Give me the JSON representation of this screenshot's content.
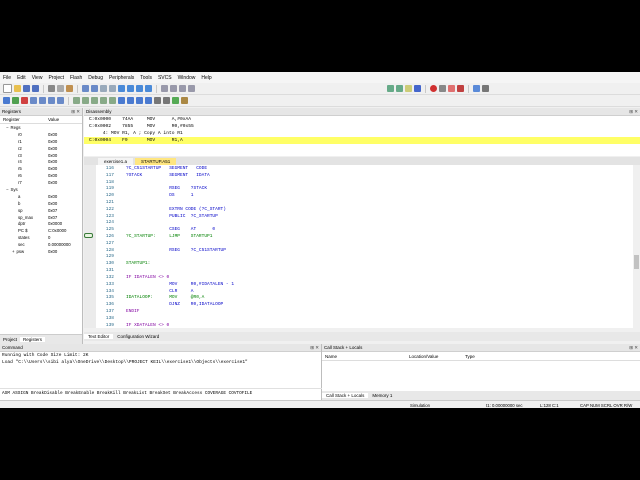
{
  "menu": [
    "File",
    "Edit",
    "View",
    "Project",
    "Flash",
    "Debug",
    "Peripherals",
    "Tools",
    "SVCS",
    "Window",
    "Help"
  ],
  "registers": {
    "title": "Registers",
    "col_register": "Register",
    "col_value": "Value",
    "rows": [
      {
        "name": "Regs",
        "value": "",
        "indent": 1,
        "tree": "−"
      },
      {
        "name": "r0",
        "value": "0x00",
        "indent": 3,
        "tree": ""
      },
      {
        "name": "r1",
        "value": "0x00",
        "indent": 3,
        "tree": ""
      },
      {
        "name": "r2",
        "value": "0x00",
        "indent": 3,
        "tree": ""
      },
      {
        "name": "r3",
        "value": "0x00",
        "indent": 3,
        "tree": ""
      },
      {
        "name": "r4",
        "value": "0x00",
        "indent": 3,
        "tree": ""
      },
      {
        "name": "r5",
        "value": "0x00",
        "indent": 3,
        "tree": ""
      },
      {
        "name": "r6",
        "value": "0x00",
        "indent": 3,
        "tree": ""
      },
      {
        "name": "r7",
        "value": "0x00",
        "indent": 3,
        "tree": ""
      },
      {
        "name": "Sys",
        "value": "",
        "indent": 1,
        "tree": "−"
      },
      {
        "name": "a",
        "value": "0x00",
        "indent": 3,
        "tree": ""
      },
      {
        "name": "b",
        "value": "0x00",
        "indent": 3,
        "tree": ""
      },
      {
        "name": "sp",
        "value": "0x07",
        "indent": 3,
        "tree": ""
      },
      {
        "name": "sp_max",
        "value": "0x07",
        "indent": 3,
        "tree": ""
      },
      {
        "name": "dptr",
        "value": "0x0000",
        "indent": 3,
        "tree": ""
      },
      {
        "name": "PC  $",
        "value": "C:0x0000",
        "indent": 3,
        "tree": ""
      },
      {
        "name": "states",
        "value": "0",
        "indent": 3,
        "tree": ""
      },
      {
        "name": "sec",
        "value": "0.00000000",
        "indent": 3,
        "tree": ""
      },
      {
        "name": "psw",
        "value": "0x00",
        "indent": 2,
        "tree": "+"
      }
    ],
    "tabs": [
      "Project",
      "Registers"
    ]
  },
  "disassembly": {
    "title": "Disassembly",
    "lines": [
      {
        "text": "C:0x0000    74AA     MOV      A,#0xAA",
        "hl": false
      },
      {
        "text": "C:0x0002    7855     MOV      R0,#0x55",
        "hl": false
      },
      {
        "text": "     4: MOV R1, A ; Copy A into R1",
        "hl": false
      },
      {
        "text": "C:0x0004    F9       MOV      R1,A",
        "hl": true
      },
      {
        "text": "",
        "hl": false
      }
    ]
  },
  "editor": {
    "tabs": [
      "exercise1.a",
      "STARTUP.A51"
    ],
    "active_tab": 1,
    "lines": [
      {
        "n": "116",
        "t": "?C_C51STARTUP   SEGMENT   CODE",
        "c": "kw"
      },
      {
        "n": "117",
        "t": "?STACK          SEGMENT   IDATA",
        "c": "kw"
      },
      {
        "n": "118",
        "t": "",
        "c": "tx"
      },
      {
        "n": "119",
        "t": "                RSEG    ?STACK",
        "c": "kw"
      },
      {
        "n": "120",
        "t": "                DS      1",
        "c": "kw"
      },
      {
        "n": "121",
        "t": "",
        "c": "tx"
      },
      {
        "n": "122",
        "t": "                EXTRN CODE (?C_START)",
        "c": "kw"
      },
      {
        "n": "123",
        "t": "                PUBLIC  ?C_STARTUP",
        "c": "kw"
      },
      {
        "n": "124",
        "t": "",
        "c": "tx"
      },
      {
        "n": "125",
        "t": "                CSEG    AT      0",
        "c": "kw"
      },
      {
        "n": "126",
        "t": "?C_STARTUP:     LJMP    STARTUP1",
        "c": "lbl"
      },
      {
        "n": "127",
        "t": "",
        "c": "tx"
      },
      {
        "n": "128",
        "t": "                RSEG    ?C_C51STARTUP",
        "c": "kw"
      },
      {
        "n": "129",
        "t": "",
        "c": "tx"
      },
      {
        "n": "130",
        "t": "STARTUP1:",
        "c": "lbl"
      },
      {
        "n": "131",
        "t": "",
        "c": "tx"
      },
      {
        "n": "132",
        "t": "IF IDATALEN <> 0",
        "c": "op"
      },
      {
        "n": "133",
        "t": "                MOV     R0,#IDATALEN - 1",
        "c": "kw"
      },
      {
        "n": "134",
        "t": "                CLR     A",
        "c": "kw"
      },
      {
        "n": "135",
        "t": "IDATALOOP:      MOV     @R0,A",
        "c": "lbl"
      },
      {
        "n": "136",
        "t": "                DJNZ    R0,IDATALOOP",
        "c": "kw"
      },
      {
        "n": "137",
        "t": "ENDIF",
        "c": "op"
      },
      {
        "n": "138",
        "t": "",
        "c": "tx"
      },
      {
        "n": "139",
        "t": "IF XDATALEN <> 0",
        "c": "op"
      }
    ],
    "bottom_tabs": [
      "Text Editor",
      "Configuration Wizard"
    ]
  },
  "command": {
    "title": "Command",
    "lines": [
      "Running with Code Size Limit: 2K",
      "Load \"C:\\\\Users\\\\sibi alya\\\\OneDrive\\\\Desktop\\\\PROJECT KEIL\\\\exercise1\\\\Objects\\\\exercise1\""
    ],
    "keywords": "ASM ASSIGN BreakDisable BreakEnable BreakKill BreakList BreakSet BreakAccess COVERAGE COVTOFILE"
  },
  "callstack": {
    "title": "Call Stack + Locals",
    "cols": [
      "Name",
      "Location/Value",
      "Type"
    ],
    "tabs": [
      "Call Stack + Locals",
      "Memory 1"
    ]
  },
  "status": {
    "mode": "Simulation",
    "time": "t1: 0.00000000 sec",
    "pos": "L:128 C:1",
    "caps": "CAP  NUM  SCRL  OVR  R/W"
  },
  "colors": {
    "highlight": "#ffff66",
    "label": "#008000",
    "keyword": "#0000c8",
    "directive": "#8000a0"
  }
}
